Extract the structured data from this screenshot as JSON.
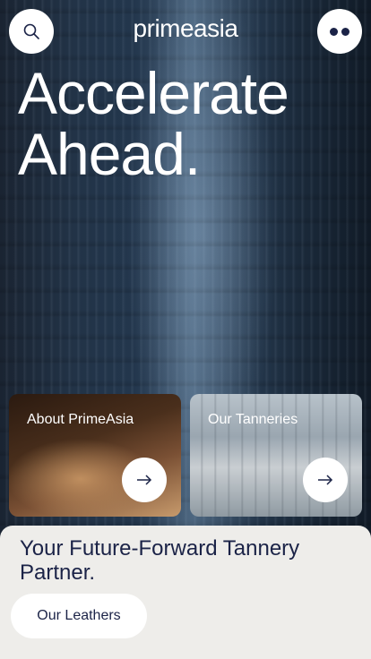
{
  "header": {
    "logo_text": "primeasia",
    "search_icon": "search-icon",
    "menu_icon": "more-dots-icon"
  },
  "hero": {
    "headline_line1": "Accelerate",
    "headline_line2": "Ahead."
  },
  "cards": [
    {
      "label": "About PrimeAsia",
      "icon": "arrow-right-icon"
    },
    {
      "label": "Our Tanneries",
      "icon": "arrow-right-icon"
    }
  ],
  "sheet": {
    "tagline": "Your Future-Forward Tannery Partner.",
    "button_label": "Our Leathers"
  },
  "colors": {
    "navy": "#1b2347",
    "sheet_bg": "#eeedea",
    "white": "#ffffff"
  }
}
